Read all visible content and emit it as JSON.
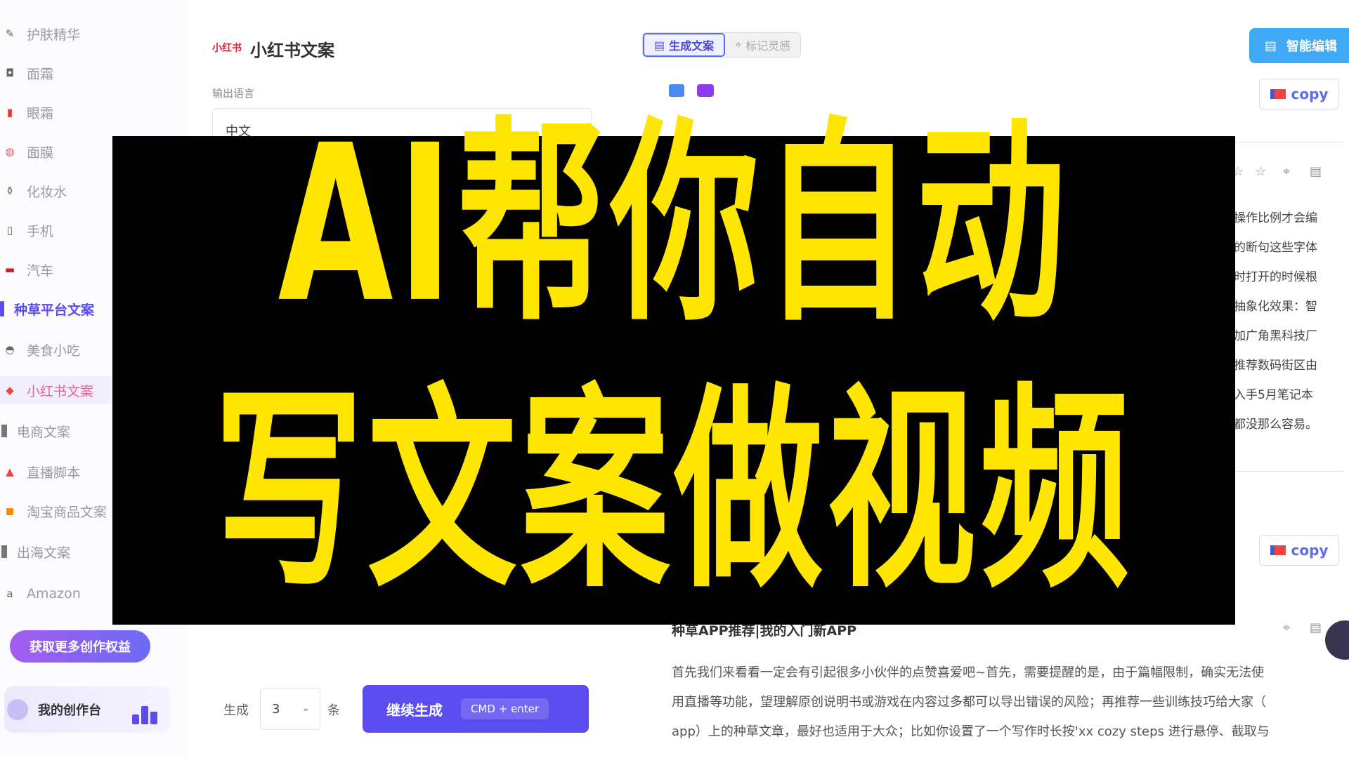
{
  "sidebar": {
    "items": [
      {
        "label": "护肤精华",
        "icon": "dropper-icon",
        "type": "item"
      },
      {
        "label": "面霜",
        "icon": "jar-icon",
        "type": "item"
      },
      {
        "label": "眼霜",
        "icon": "tube-icon",
        "type": "item"
      },
      {
        "label": "面膜",
        "icon": "mask-icon",
        "type": "item"
      },
      {
        "label": "化妆水",
        "icon": "bottle-icon",
        "type": "item"
      },
      {
        "label": "手机",
        "icon": "phone-icon",
        "type": "item"
      },
      {
        "label": "汽车",
        "icon": "car-icon",
        "type": "item"
      },
      {
        "label": "种草平台文案",
        "icon": "",
        "type": "group"
      },
      {
        "label": "美食小吃",
        "icon": "bowl-icon",
        "type": "item"
      },
      {
        "label": "小红书文案",
        "icon": "xiaohongshu-icon",
        "type": "active"
      },
      {
        "label": "电商文案",
        "icon": "",
        "type": "plain"
      },
      {
        "label": "直播脚本",
        "icon": "live-icon",
        "type": "item"
      },
      {
        "label": "淘宝商品文案",
        "icon": "taobao-icon",
        "type": "item"
      },
      {
        "label": "出海文案",
        "icon": "",
        "type": "plain"
      },
      {
        "label": "Amazon",
        "icon": "amazon-icon",
        "type": "item"
      }
    ],
    "cta_label": "获取更多创作权益",
    "studio_label": "我的创作台"
  },
  "main": {
    "logo_text": "小红书",
    "title": "小红书文案",
    "output_language_label": "输出语言",
    "output_language_value": "中文",
    "generate_label": "生成",
    "generate_count": "3",
    "generate_unit": "条",
    "continue_label": "继续生成",
    "continue_shortcut": "CMD + enter"
  },
  "right": {
    "tabs": [
      {
        "label": "生成文案",
        "icon": "document-icon",
        "active": true
      },
      {
        "label": "标记灵感",
        "icon": "pin-icon",
        "active": false
      }
    ],
    "smart_edit_label": "智能编辑",
    "copy_label": "copy",
    "card_lines": [
      "操作比例才会编",
      "的断句这些字体",
      "时打开的时候根",
      "抽象化效果：智",
      "加广角黑科技厂",
      "推荐数码街区由",
      "入手5月笔记本",
      "都没那么容易。"
    ],
    "article_title": "种草APP推荐|我的入门新APP",
    "article_lines": [
      "首先我们来看看一定会有引起很多小伙伴的点赞喜爱吧~首先，需要提醒的是，由于篇幅限制，确实无法使",
      "用直播等功能，望理解原创说明书或游戏在内容过多都可以导出错误的风险；再推荐一些训练技巧给大家（",
      "app）上的种草文章，最好也适用于大众；比如你设置了一个写作时长按'xx cozy steps 进行悬停、截取与"
    ]
  },
  "overlay": {
    "line1": "AI帮你自动",
    "line2": "写文案做视频",
    "color": "#ffe600",
    "background": "#000000"
  }
}
